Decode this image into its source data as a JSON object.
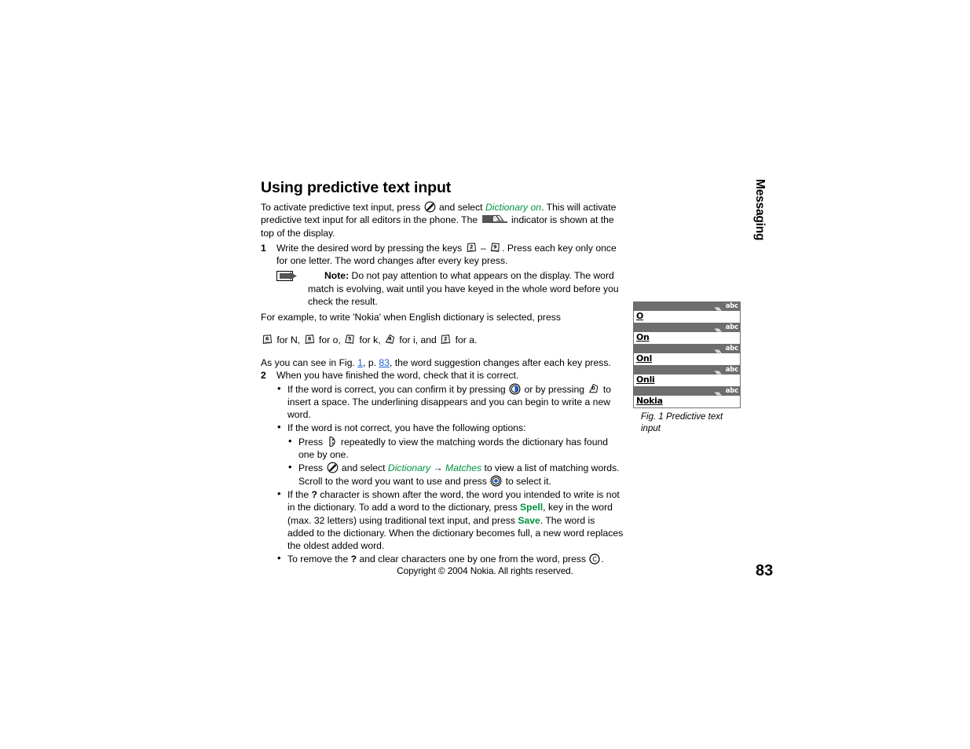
{
  "heading": "Using predictive text input",
  "intro": {
    "t1": "To activate predictive text input, press ",
    "t2": " and select ",
    "dictionary_on": "Dictionary on",
    "t3": ". This will activate predictive text input for all editors in the phone. The ",
    "t4": " indicator is shown at the top of the display."
  },
  "step1": {
    "num": "1",
    "t1": "Write the desired word by pressing the keys ",
    "key_from": "2",
    "dash": " – ",
    "key_to": "9",
    "t2": ". Press each key only once for one letter. The word changes after every key press."
  },
  "note": {
    "label": "Note:",
    "text": " Do not pay attention to what appears on the display. The word match is evolving, wait until you have keyed in the whole word before you check the result."
  },
  "example": {
    "lead": "For example, to write 'Nokia' when English dictionary is selected, press",
    "keys": [
      {
        "key": "6",
        "label": " for N, "
      },
      {
        "key": "6",
        "label": " for o, "
      },
      {
        "key": "5",
        "label": " for k, "
      },
      {
        "key": "4",
        "label": " for i, and "
      },
      {
        "key": "2",
        "label": " for a."
      }
    ]
  },
  "figref": {
    "t1": "As you can see in Fig. ",
    "fig_link": "1",
    "t2": ", p. ",
    "page_link": "83",
    "t3": ", the word suggestion changes after each key press."
  },
  "step2": {
    "num": "2",
    "text": "When you have finished the word, check that it is correct."
  },
  "bullets": {
    "b1_a": {
      "t1": "If the word is correct, you can confirm it by pressing ",
      "t2": " or by pressing ",
      "key_space": "0",
      "t3": " to insert a space. The underlining disappears and you can begin to write a new word."
    },
    "b1_b": "If the word is not correct, you have the following options:",
    "b2_a": {
      "t1": "Press ",
      "t2": " repeatedly to view the matching words the dictionary has found one by one."
    },
    "b2_b": {
      "t1": "Press ",
      "t2": " and select ",
      "dictionary": "Dictionary",
      "arrow": " → ",
      "matches": "Matches",
      "t3": " to view a list of matching words. Scroll to the word you want to use and press ",
      "t4": " to select it."
    },
    "b1_c": {
      "t1": "If the ",
      "qmark": "?",
      "t2": " character is shown after the word, the word you intended to write is not in the dictionary. To add a word to the dictionary, press ",
      "spell": "Spell",
      "t3": ", key in the word (max. 32 letters) using traditional text input, and press ",
      "save": "Save",
      "t4": ". The word is added to the dictionary. When the dictionary becomes full, a new word replaces the oldest added word."
    },
    "b1_d": {
      "t1": "To remove the ",
      "qmark": "?",
      "t2": " and clear characters one by one from the word, press ",
      "t3": "."
    }
  },
  "figure": {
    "rows": [
      {
        "status_mode": "abc",
        "word": "O"
      },
      {
        "status_mode": "abc",
        "word": "On"
      },
      {
        "status_mode": "abc",
        "word": "Onl"
      },
      {
        "status_mode": "abc",
        "word": "Onli"
      },
      {
        "status_mode": "abc",
        "word": "Nokia"
      }
    ],
    "caption": "Fig. 1 Predictive text input"
  },
  "sidetab": {
    "label": "Messaging"
  },
  "footer": {
    "copyright": "Copyright © 2004 Nokia. All rights reserved."
  },
  "page_number": "83",
  "colors": {
    "green": "#00923f",
    "link_blue": "#1a5fd4",
    "status_gray": "#6e6e6e",
    "joystick_blue": "#1a5fd4"
  }
}
